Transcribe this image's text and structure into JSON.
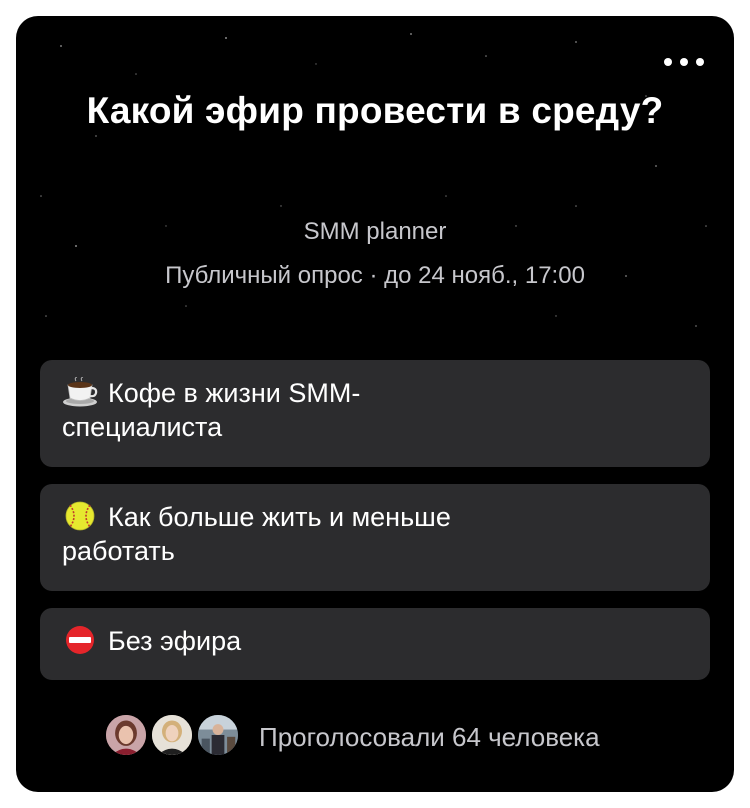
{
  "poll": {
    "title": "Какой эфир провести в среду?",
    "author": "SMM planner",
    "meta": "Публичный опрос · до 24 нояб., 17:00",
    "menu_icon": "more-horizontal-icon",
    "options": [
      {
        "icon": "coffee-cup-icon",
        "label": "Кофе в жизни SMM-специалиста"
      },
      {
        "icon": "softball-icon",
        "label": "Как больше жить и меньше работать"
      },
      {
        "icon": "no-entry-icon",
        "label": "Без эфира"
      }
    ],
    "votes_text": "Проголосовали 64 человека",
    "voter_avatars": [
      "avatar-1",
      "avatar-2",
      "avatar-3"
    ]
  },
  "colors": {
    "card_background": "#000000",
    "option_background": "#2c2c2e",
    "primary_text": "#ffffff",
    "secondary_text": "#c7c7cc"
  }
}
